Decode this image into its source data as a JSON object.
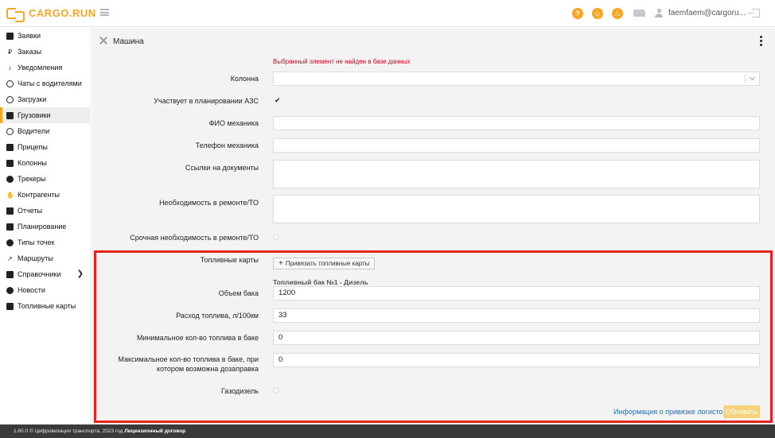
{
  "header": {
    "logo_text": "CARGO.RUN",
    "user_email": "faemfaem@cargoru...",
    "icons": [
      "help-icon",
      "chat-icon",
      "fire-icon",
      "truck-icon",
      "user-icon",
      "logout-icon"
    ],
    "help_glyph": "?",
    "chat_glyph": "☺",
    "fire_glyph": "♨",
    "accent_color": "#f5a623"
  },
  "sidebar": {
    "items": [
      {
        "label": "Заявки"
      },
      {
        "label": "Заказы"
      },
      {
        "label": "Уведомления"
      },
      {
        "label": "Чаты с водителями"
      },
      {
        "label": "Загрузки"
      },
      {
        "label": "Грузовики"
      },
      {
        "label": "Водители"
      },
      {
        "label": "Прицепы"
      },
      {
        "label": "Колонны"
      },
      {
        "label": "Трекеры"
      },
      {
        "label": "Контрагенты"
      },
      {
        "label": "Отчеты"
      },
      {
        "label": "Планирование"
      },
      {
        "label": "Типы точек"
      },
      {
        "label": "Маршруты"
      },
      {
        "label": "Справочники"
      },
      {
        "label": "Новости"
      },
      {
        "label": "Топливные карты"
      }
    ],
    "active": "Грузовики"
  },
  "panel": {
    "title": "Машина",
    "error": "Выбранный элемент не найден в базе данных",
    "column_label": "Колонна",
    "column_value": "",
    "azs_label": "Участвует в планировании АЗС",
    "azs_checked": "✔",
    "mechanic_name_label": "ФИО механика",
    "mechanic_name_value": "",
    "mechanic_phone_label": "Телефон механика",
    "mechanic_phone_value": "",
    "docs_label": "Ссылки на документы",
    "docs_value": "",
    "repair_label": "Необходимость в ремонте/ТО",
    "repair_value": "",
    "urgent_repair_label": "Срочная необходимость в ремонте/ТО"
  },
  "fuel": {
    "cards_label": "Топливные карты",
    "bind_button": "Привязать топливные карты",
    "tank_title": "Топливный бак №1 - Дизель",
    "volume_label": "Объем бака",
    "volume_value": "1200",
    "consumption_label": "Расход топлива, л/100км",
    "consumption_value": "33",
    "min_label": "Минимальное кол-во топлива в баке",
    "min_value": "0",
    "max_label_1": "Максимальное кол-во топлива в баке, при",
    "max_label_2": "котором возможна дозаправка",
    "max_value": "0",
    "gasdiesel_label": "Газодизель"
  },
  "actions": {
    "info_link": "Информация о привязке логистов",
    "update_button": "Обновить"
  },
  "footer": {
    "text": "1.60.0 © Цифровизация транспорта, 2023 год",
    "license": "Лицензионный договор"
  }
}
